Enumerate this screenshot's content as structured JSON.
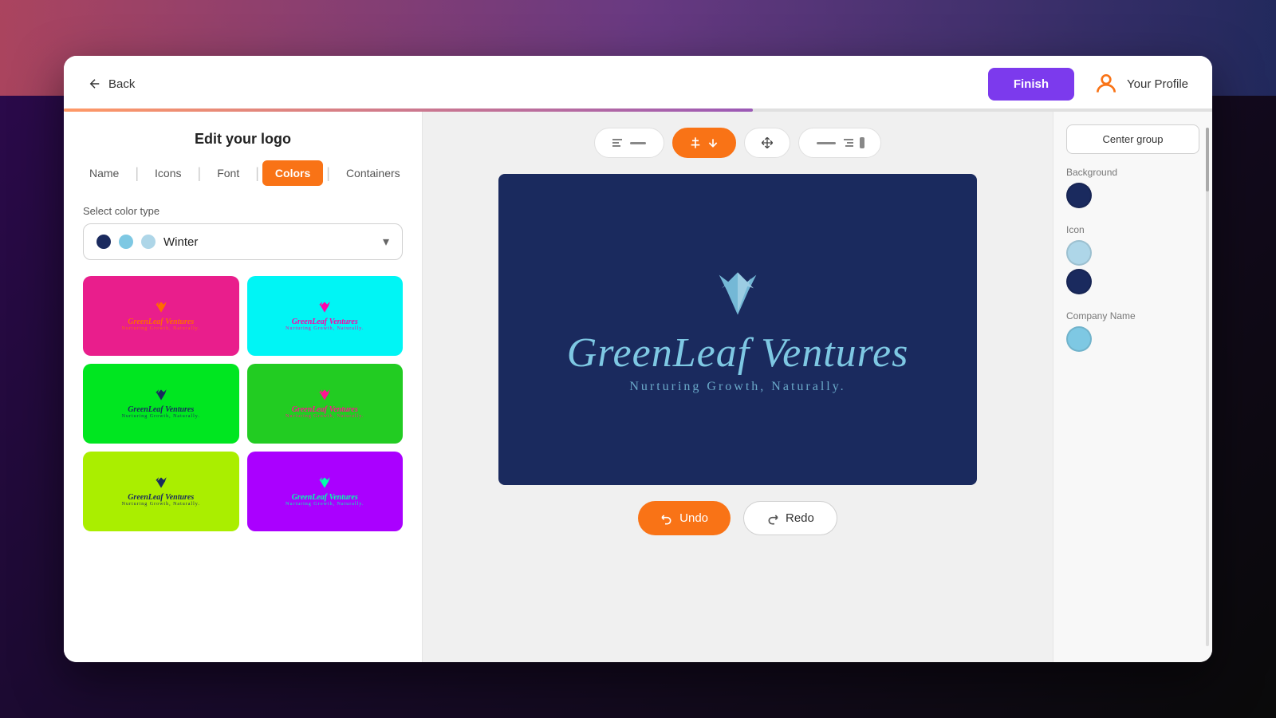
{
  "header": {
    "back_label": "Back",
    "finish_label": "Finish",
    "profile_label": "Your Profile",
    "progress_percent": 60
  },
  "left_panel": {
    "title": "Edit your logo",
    "tabs": [
      {
        "id": "name",
        "label": "Name",
        "active": false
      },
      {
        "id": "icons",
        "label": "Icons",
        "active": false
      },
      {
        "id": "font",
        "label": "Font",
        "active": false
      },
      {
        "id": "colors",
        "label": "Colors",
        "active": true
      },
      {
        "id": "containers",
        "label": "Containers",
        "active": false
      }
    ],
    "color_type_label": "Select color type",
    "dropdown": {
      "selected": "Winter",
      "dots": [
        "#1a2a5e",
        "#7ec8e3",
        "#aed6e8"
      ]
    },
    "swatches": [
      {
        "bg": "#e91e8c",
        "text_color": "#ff6b00",
        "tagline_color": "#ff6b00"
      },
      {
        "bg": "#00f5f5",
        "text_color": "#ff00aa",
        "tagline_color": "#ff00aa"
      },
      {
        "bg": "#00e620",
        "text_color": "#1a2a5e",
        "tagline_color": "#1a2a5e"
      },
      {
        "bg": "#22cc22",
        "text_color": "#ff1493",
        "tagline_color": "#ff1493"
      },
      {
        "bg": "#aaee00",
        "text_color": "#1a2a5e",
        "tagline_color": "#1a2a5e"
      },
      {
        "bg": "#aa00ff",
        "text_color": "#00ffaa",
        "tagline_color": "#00ffaa"
      }
    ]
  },
  "canvas": {
    "company_name": "GreenLeaf Ventures",
    "tagline": "Nurturing Growth, Naturally.",
    "background_color": "#1a2a5e",
    "text_color": "#7ec8e3"
  },
  "toolbar": {
    "tools": [
      {
        "id": "left-align",
        "icon": "left-align",
        "active": false
      },
      {
        "id": "center-icon",
        "icon": "center-icon",
        "active": true
      },
      {
        "id": "move",
        "icon": "move",
        "active": false
      },
      {
        "id": "right-align",
        "icon": "right-align",
        "active": false
      }
    ]
  },
  "bottom_actions": {
    "undo_label": "Undo",
    "redo_label": "Redo"
  },
  "right_sidebar": {
    "center_group_label": "Center group",
    "sections": [
      {
        "label": "Background",
        "colors": [
          "#1a2a5e"
        ]
      },
      {
        "label": "Icon",
        "colors": [
          "#aed6e8",
          "#1a2a5e"
        ]
      },
      {
        "label": "Company Name",
        "colors": [
          "#7ec8e3"
        ]
      }
    ]
  }
}
